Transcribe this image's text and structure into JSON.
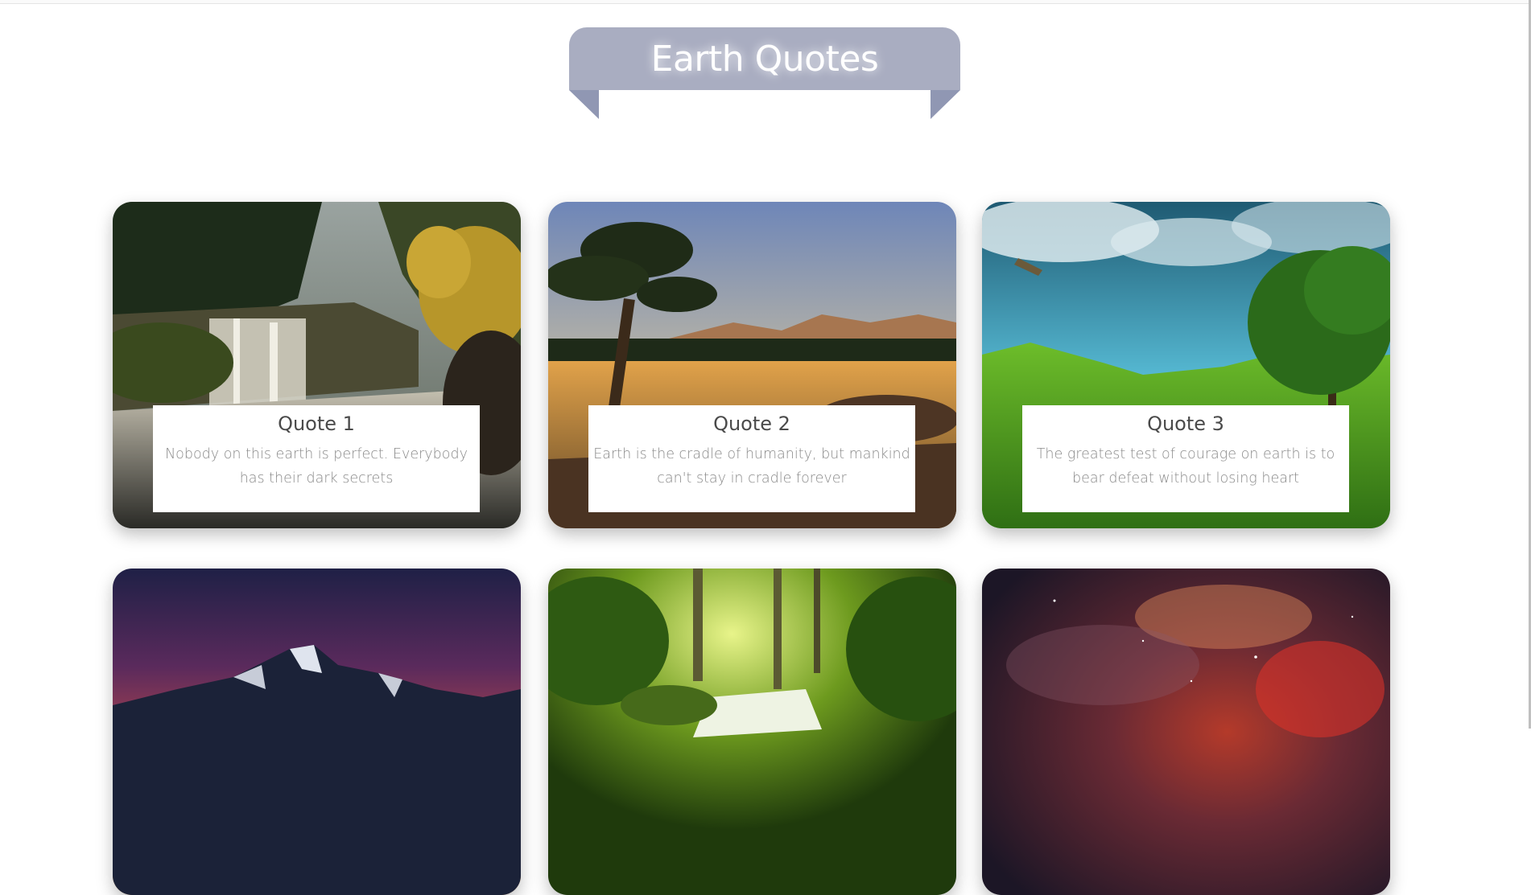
{
  "header": {
    "title": "Earth Quotes",
    "ribbon_color": "#a9adc1"
  },
  "cards": [
    {
      "title": "Quote 1",
      "text": "Nobody on this earth is perfect. Everybody has their dark secrets",
      "scene": "waterfall-forest"
    },
    {
      "title": "Quote 2",
      "text": "Earth is the cradle of humanity, but mankind can't stay in cradle forever",
      "scene": "lake-sunset-tree"
    },
    {
      "title": "Quote 3",
      "text": "The greatest test of courage on earth is to bear defeat without losing heart",
      "scene": "green-meadow-tree"
    },
    {
      "scene": "mountain-sunset"
    },
    {
      "scene": "forest-stream"
    },
    {
      "scene": "red-nebula"
    }
  ]
}
